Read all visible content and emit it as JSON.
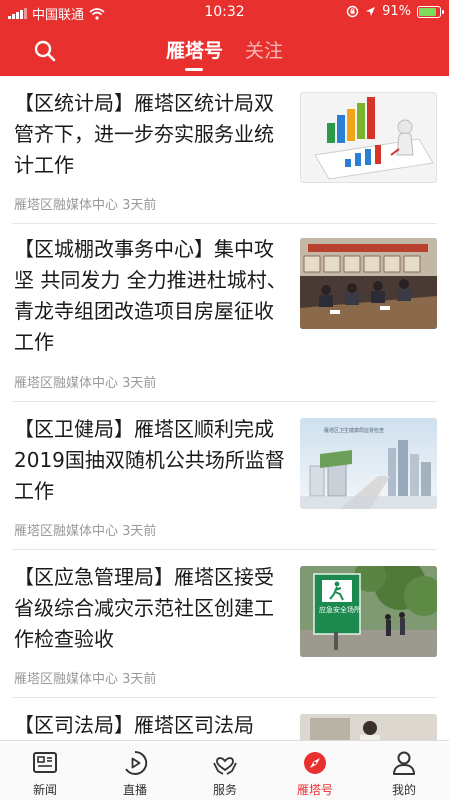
{
  "status_bar": {
    "carrier": "中国联通",
    "time": "10:32",
    "battery": "91%",
    "battery_level": 0.91
  },
  "top_nav": {
    "search_icon": "search-icon",
    "tabs": [
      {
        "label": "雁塔号",
        "active": true
      },
      {
        "label": "关注",
        "active": false
      }
    ],
    "accent_color": "#e8302f"
  },
  "feed": {
    "items": [
      {
        "title": "【区统计局】雁塔区统计局双管齐下，进一步夯实服务业统计工作",
        "source": "雁塔区融媒体中心",
        "time": "3天前",
        "thumb": "statistics-chart-image"
      },
      {
        "title": "【区城棚改事务中心】集中攻坚 共同发力 全力推进杜城村、青龙寺组团改造项目房屋征收工作",
        "source": "雁塔区融媒体中心",
        "time": "3天前",
        "thumb": "meeting-room-image"
      },
      {
        "title": "【区卫健局】雁塔区顺利完成 2019国抽双随机公共场所监督工作",
        "source": "雁塔区融媒体中心",
        "time": "3天前",
        "thumb": "city-buildings-image"
      },
      {
        "title": "【区应急管理局】雁塔区接受省级综合减灾示范社区创建工作检查验收",
        "source": "雁塔区融媒体中心",
        "time": "3天前",
        "thumb": "emergency-shelter-sign-image"
      },
      {
        "title": "【区司法局】雁塔区司法局",
        "source": "",
        "time": "",
        "thumb": "office-image"
      }
    ],
    "thumb_text": {
      "emergency_sign": "应急安全场所",
      "city_banner": "雁塔区卫生健康局监督检查"
    }
  },
  "tab_bar": {
    "items": [
      {
        "label": "新闻",
        "icon": "newspaper-icon",
        "active": false
      },
      {
        "label": "直播",
        "icon": "play-circle-icon",
        "active": false
      },
      {
        "label": "服务",
        "icon": "heart-hands-icon",
        "active": false
      },
      {
        "label": "雁塔号",
        "icon": "compass-icon",
        "active": true
      },
      {
        "label": "我的",
        "icon": "person-icon",
        "active": false
      }
    ]
  }
}
